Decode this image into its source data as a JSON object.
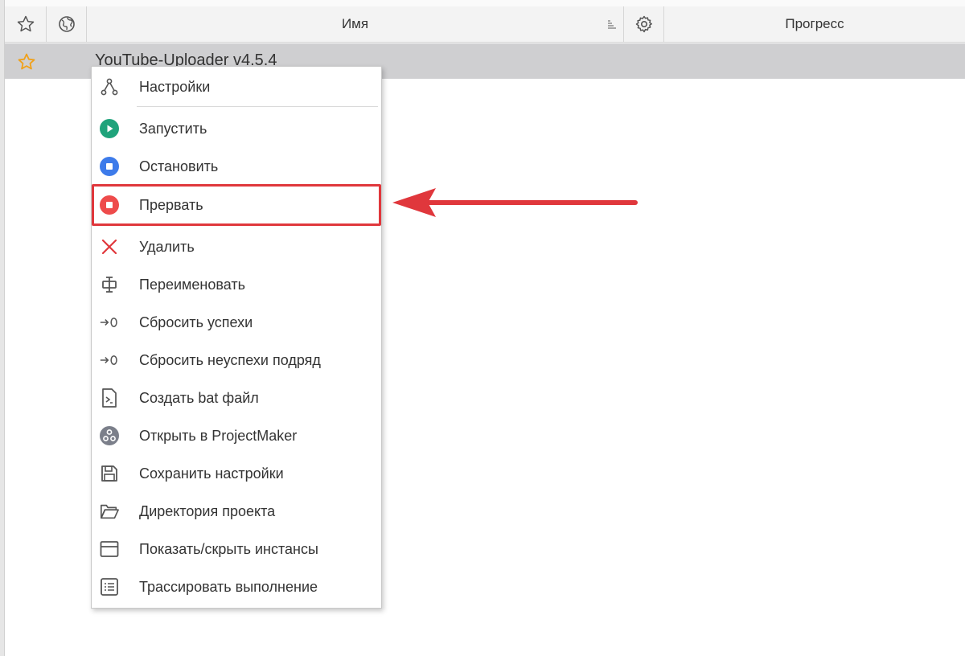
{
  "table": {
    "columns": {
      "favorite_icon": "star-icon",
      "status_icon": "globe-icon",
      "name": "Имя",
      "settings_icon": "gear-icon",
      "progress": "Прогресс"
    },
    "rows": [
      {
        "name": "YouTube-Uploader v4.5.4",
        "favorite": true
      }
    ]
  },
  "context_menu": {
    "items": [
      {
        "label": "Настройки",
        "icon": "tree-icon"
      },
      {
        "label": "Запустить",
        "icon": "play-icon"
      },
      {
        "label": "Остановить",
        "icon": "stop-icon"
      },
      {
        "label": "Прервать",
        "icon": "abort-icon",
        "highlighted": true
      },
      {
        "label": "Удалить",
        "icon": "close-icon"
      },
      {
        "label": "Переименовать",
        "icon": "rename-icon"
      },
      {
        "label": "Сбросить успехи",
        "icon": "reset-icon"
      },
      {
        "label": "Сбросить неуспехи подряд",
        "icon": "reset-icon"
      },
      {
        "label": "Создать bat файл",
        "icon": "terminal-file-icon"
      },
      {
        "label": "Открыть в ProjectMaker",
        "icon": "projectmaker-icon"
      },
      {
        "label": "Сохранить настройки",
        "icon": "save-icon"
      },
      {
        "label": "Директория проекта",
        "icon": "folder-icon"
      },
      {
        "label": "Показать/скрыть инстансы",
        "icon": "window-icon"
      },
      {
        "label": "Трассировать выполнение",
        "icon": "list-icon"
      }
    ]
  },
  "colors": {
    "play": "#1fa37b",
    "stop": "#3d7bea",
    "abort": "#ee4b4b",
    "delete": "#e0373c",
    "highlight_border": "#e0373c",
    "arrow": "#e0373c",
    "star_active": "#f0a11a",
    "row_selected": "#cfcfd1"
  }
}
